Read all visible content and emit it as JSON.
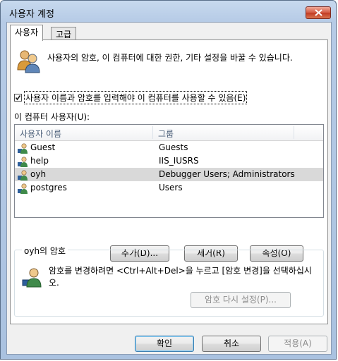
{
  "window": {
    "title": "사용자 계정"
  },
  "tabs": [
    {
      "label": "사용자",
      "active": true
    },
    {
      "label": "고급",
      "active": false
    }
  ],
  "description": "사용자의 암호, 이 컴퓨터에 대한  권한, 기타 설정을 바꿀 수 있습니다.",
  "require_login": {
    "label": "사용자 이름과 암호를 입력해야 이 컴퓨터를 사용할 수 있음(E)",
    "checked": true
  },
  "users_label": "이 컴퓨터 사용자(U):",
  "list": {
    "columns": [
      "사용자 이름",
      "그룹"
    ],
    "rows": [
      {
        "name": "Guest",
        "group": "Guests",
        "selected": false
      },
      {
        "name": "help",
        "group": "IIS_IUSRS",
        "selected": false
      },
      {
        "name": "oyh",
        "group": "Debugger Users; Administrators",
        "selected": true
      },
      {
        "name": "postgres",
        "group": "Users",
        "selected": false
      }
    ]
  },
  "list_buttons": {
    "add": "추가(D)...",
    "remove": "제거(R)",
    "properties": "속성(O)"
  },
  "password_group": {
    "title": "oyh의 암호",
    "text": "암호를 변경하려면 <Ctrl+Alt+Del>을 누르고 [암호 변경]을 선택하십시오.",
    "reset_button": "암호 다시 설정(P)..."
  },
  "dialog_buttons": {
    "ok": "확인",
    "cancel": "취소",
    "apply": "적용(A)"
  },
  "icons": {
    "users": "users-icon",
    "user": "user-icon",
    "close": "close-icon",
    "key_user": "user-key-icon"
  },
  "colors": {
    "title_bar": "#b6cbe6",
    "selected_row": "#d9d9d9",
    "close_button": "#c23a22"
  }
}
